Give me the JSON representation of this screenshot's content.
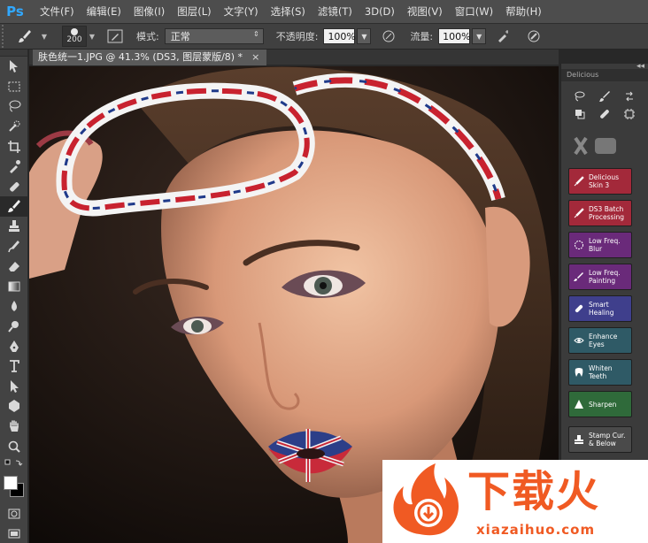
{
  "app": {
    "logo": "Ps"
  },
  "menu": [
    "文件(F)",
    "编辑(E)",
    "图像(I)",
    "图层(L)",
    "文字(Y)",
    "选择(S)",
    "滤镜(T)",
    "3D(D)",
    "视图(V)",
    "窗口(W)",
    "帮助(H)"
  ],
  "options": {
    "brush_size": "200",
    "mode_label": "模式:",
    "mode_value": "正常",
    "opacity_label": "不透明度:",
    "opacity_value": "100%",
    "flow_label": "流量:",
    "flow_value": "100%"
  },
  "document": {
    "tab_title": "肤色统一1.JPG @ 41.3% (DS3, 图层蒙版/8) *",
    "close_symbol": "×"
  },
  "tools": [
    "move-tool-icon",
    "marquee-tool-icon",
    "lasso-tool-icon",
    "quick-selection-tool-icon",
    "crop-tool-icon",
    "eyedropper-tool-icon",
    "healing-brush-tool-icon",
    "brush-tool-icon",
    "clone-stamp-tool-icon",
    "history-brush-tool-icon",
    "eraser-tool-icon",
    "gradient-tool-icon",
    "blur-tool-icon",
    "dodge-tool-icon",
    "pen-tool-icon",
    "type-tool-icon",
    "path-selection-tool-icon",
    "shape-tool-icon",
    "hand-tool-icon",
    "zoom-tool-icon"
  ],
  "panel": {
    "title": "Delicious",
    "buttons": [
      {
        "label": "Delicious Skin 3",
        "color": "#a3293a"
      },
      {
        "label": "DS3 Batch Processing",
        "color": "#a3293a"
      },
      {
        "label": "Low Freq. Blur",
        "color": "#6a2a7a"
      },
      {
        "label": "Low Freq. Painting",
        "color": "#6a2a7a"
      },
      {
        "label": "Smart Healing",
        "color": "#3f3f8c"
      },
      {
        "label": "Enhance Eyes",
        "color": "#2f5a66"
      },
      {
        "label": "Whiten Teeth",
        "color": "#2f5a66"
      },
      {
        "label": "Sharpen",
        "color": "#2f6a3a"
      },
      {
        "label": "Stamp Cur. & Below",
        "color": "#4a4a4a"
      }
    ]
  },
  "watermark": {
    "brand": "下载火",
    "url": "xiazaihuo.com",
    "color": "#f05a23"
  }
}
